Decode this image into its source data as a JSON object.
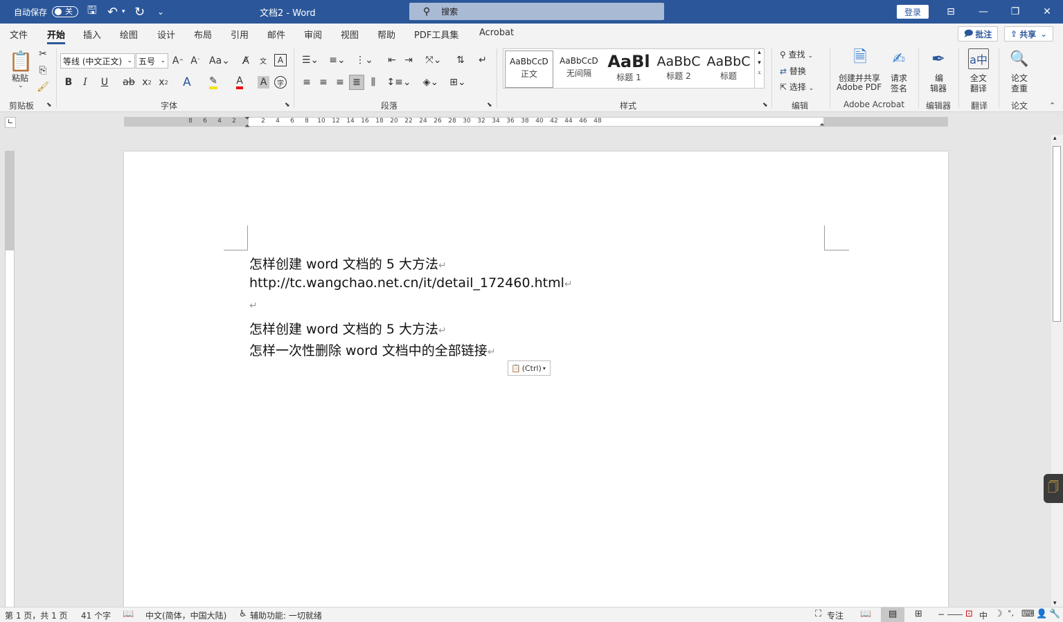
{
  "titlebar": {
    "autosave_label": "自动保存",
    "autosave_state": "关",
    "doc_title": "文档2  -  Word",
    "search_placeholder": "搜索",
    "login": "登录"
  },
  "menu": {
    "tabs": [
      "文件",
      "开始",
      "插入",
      "绘图",
      "设计",
      "布局",
      "引用",
      "邮件",
      "审阅",
      "视图",
      "帮助",
      "PDF工具集",
      "Acrobat"
    ],
    "active_tab": "开始",
    "comments": "批注",
    "share": "共享"
  },
  "ribbon": {
    "clipboard": {
      "paste": "粘贴",
      "group": "剪贴板"
    },
    "font": {
      "font_name": "等线 (中文正文)",
      "font_size": "五号",
      "group": "字体"
    },
    "paragraph": {
      "group": "段落"
    },
    "styles": {
      "group": "样式",
      "items": [
        {
          "preview": "AaBbCcD",
          "name": "正文"
        },
        {
          "preview": "AaBbCcD",
          "name": "无间隔"
        },
        {
          "preview": "AaBl",
          "name": "标题 1"
        },
        {
          "preview": "AaBbC",
          "name": "标题 2"
        },
        {
          "preview": "AaBbC",
          "name": "标题"
        }
      ]
    },
    "editing": {
      "find": "查找",
      "replace": "替换",
      "select": "选择",
      "group": "编辑"
    },
    "acrobat": {
      "create_share_l1": "创建并共享",
      "create_share_l2": "Adobe PDF",
      "request_l1": "请求",
      "request_l2": "签名",
      "group": "Adobe Acrobat"
    },
    "editor": {
      "label_l1": "编",
      "label_l2": "辑器",
      "group": "编辑器"
    },
    "translate": {
      "label_l1": "全文",
      "label_l2": "翻译",
      "group": "翻译"
    },
    "paper": {
      "label_l1": "论文",
      "label_l2": "查重",
      "group": "论文"
    }
  },
  "ruler": {
    "numbers": [
      "8",
      "6",
      "4",
      "2",
      "2",
      "4",
      "6",
      "8",
      "10",
      "12",
      "14",
      "16",
      "18",
      "20",
      "22",
      "24",
      "26",
      "28",
      "30",
      "32",
      "34",
      "36",
      "38",
      "40",
      "42",
      "44",
      "46",
      "48"
    ]
  },
  "document": {
    "lines": [
      "怎样创建 word 文档的 5 大方法",
      "http://tc.wangchao.net.cn/it/detail_172460.html",
      "",
      "怎样创建 word 文档的 5 大方法",
      "怎样一次性删除 word 文档中的全部链接"
    ],
    "paste_options": "(Ctrl)"
  },
  "statusbar": {
    "page": "第 1 页，共 1 页",
    "words": "41 个字",
    "language": "中文(简体，中国大陆)",
    "accessibility": "辅助功能: 一切就绪",
    "focus": "专注",
    "ime": "中"
  }
}
